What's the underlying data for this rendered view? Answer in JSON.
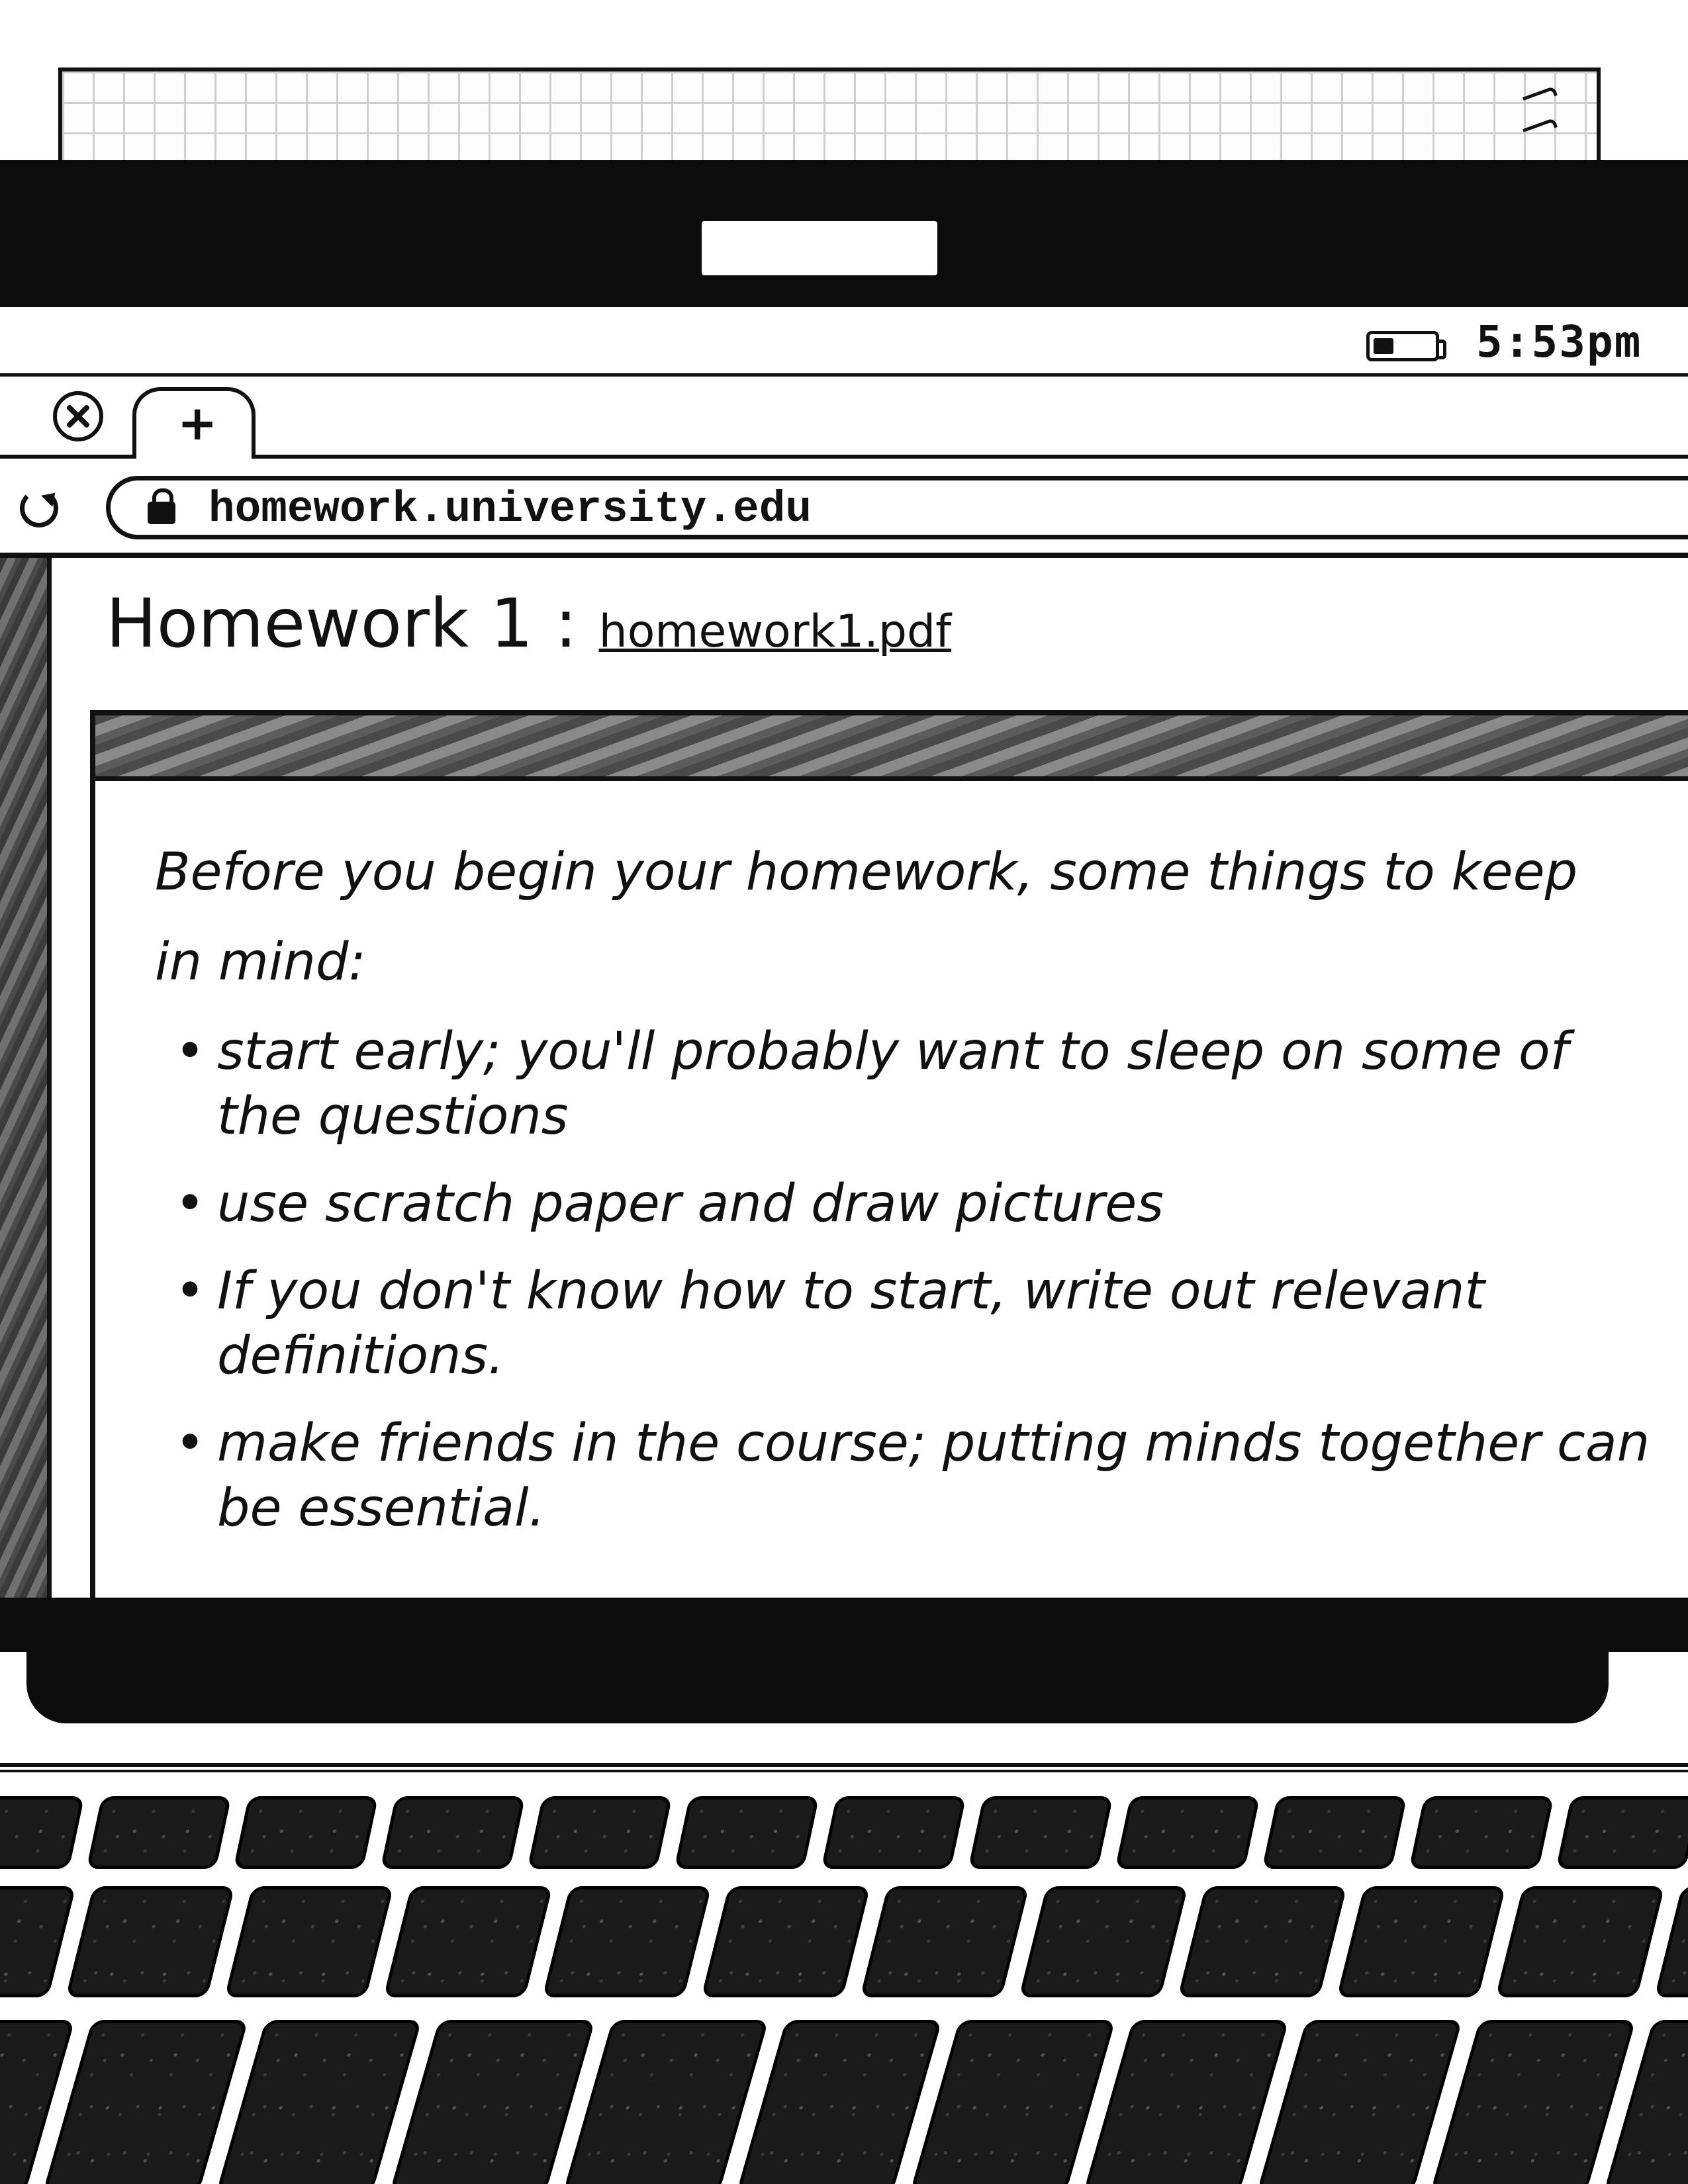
{
  "status_bar": {
    "time": "5:53pm",
    "battery_icon": "battery-low-icon"
  },
  "tabs": {
    "close_icon": "close-icon",
    "new_tab_label": "+"
  },
  "address_bar": {
    "reload_icon": "reload-icon",
    "lock_icon": "lock-icon",
    "url": "homework.university.edu"
  },
  "page": {
    "heading": "Homework 1 :",
    "attachment_link": "homework1.pdf"
  },
  "document": {
    "intro": "Before you begin your homework, some things to keep in mind:",
    "items": [
      "start early; you'll probably want to sleep on some of the questions",
      "use scratch paper and draw pictures",
      "If you don't know how to start, write out relevant definitions.",
      "make friends in the course; putting minds together can be essential."
    ]
  },
  "colors": {
    "ink": "#111111",
    "paper": "#ffffff",
    "bezel": "#0c0c0c"
  }
}
